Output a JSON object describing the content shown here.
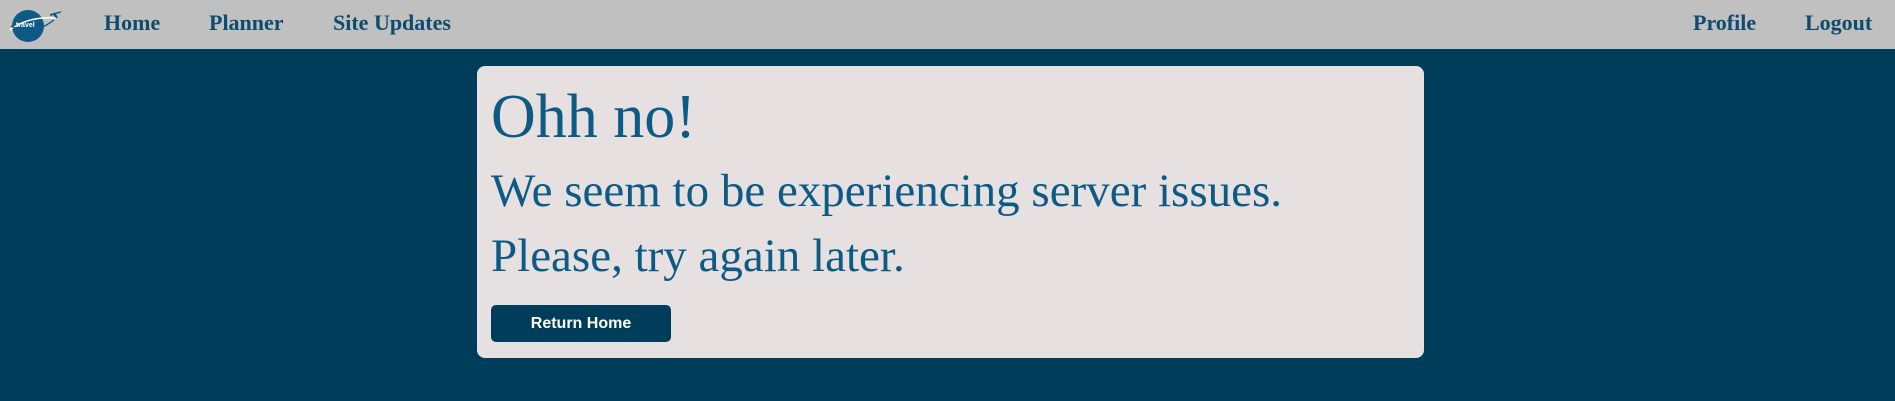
{
  "nav": {
    "logo_text": "travel",
    "links": [
      {
        "label": "Home"
      },
      {
        "label": "Planner"
      },
      {
        "label": "Site Updates"
      }
    ],
    "right_links": [
      {
        "label": "Profile"
      },
      {
        "label": "Logout"
      }
    ]
  },
  "error": {
    "title": "Ohh no!",
    "line1": "We seem to be experiencing server issues.",
    "line2": "Please, try again later.",
    "button_label": "Return Home"
  },
  "colors": {
    "navbar_bg": "#c0c0c0",
    "page_bg": "#003d5b",
    "card_bg": "#e6e0e1",
    "text_blue": "#0d5a85",
    "nav_text": "#0f4b6e"
  }
}
